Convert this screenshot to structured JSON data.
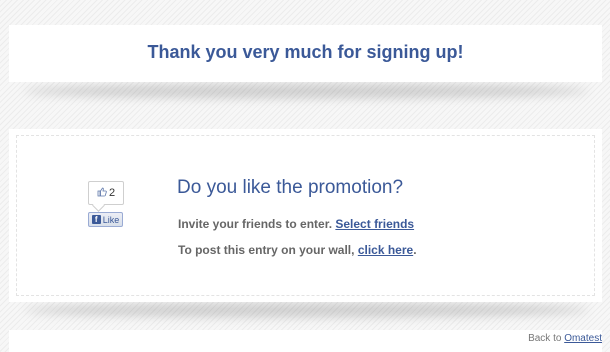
{
  "header": {
    "title": "Thank you very much for signing up!"
  },
  "like_widget": {
    "count": "2",
    "button_label": "Like",
    "logo_letter": "f"
  },
  "promo": {
    "title": "Do you like the promotion?",
    "invite_text": "Invite your friends to enter.",
    "invite_link": "Select friends",
    "post_text": "To post this entry on your wall,",
    "post_link": "click here",
    "post_suffix": "."
  },
  "footer": {
    "back_text": "Back to",
    "back_link": "Omatest"
  },
  "colors": {
    "brand": "#3b5998",
    "body_text": "#666666",
    "background": "#f3f3f3"
  }
}
